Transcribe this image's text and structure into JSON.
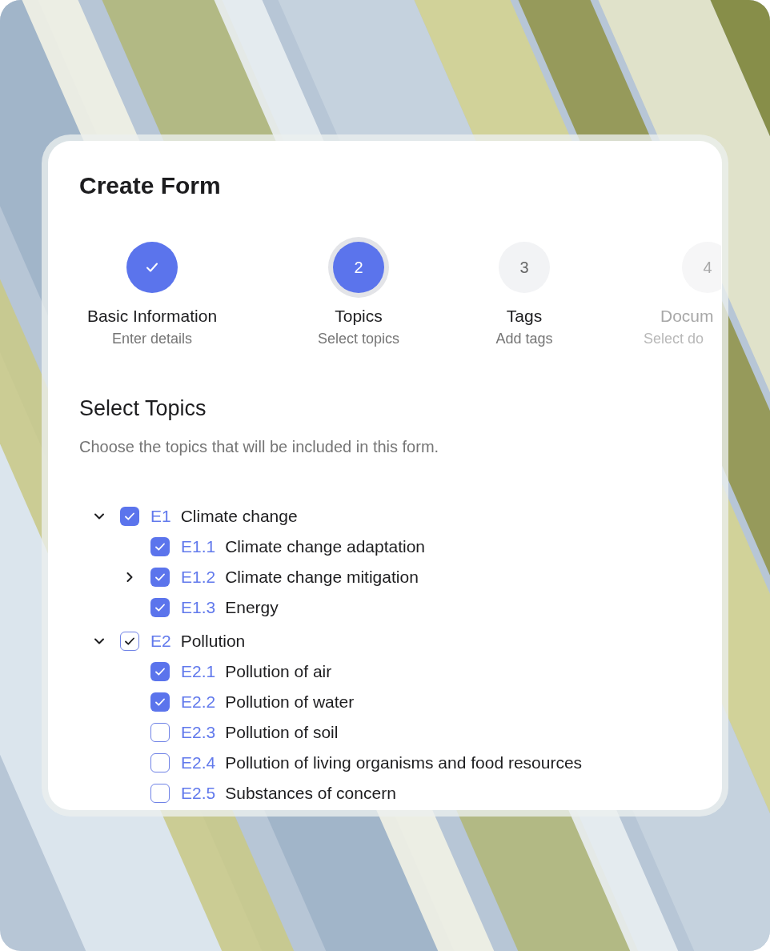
{
  "title": "Create Form",
  "steps": [
    {
      "completed": true,
      "selected": false,
      "disabled": false,
      "title": "Basic Information",
      "subtitle": "Enter details"
    },
    {
      "completed": false,
      "selected": true,
      "disabled": false,
      "number": "2",
      "title": "Topics",
      "subtitle": "Select topics"
    },
    {
      "completed": false,
      "selected": false,
      "disabled": false,
      "number": "3",
      "title": "Tags",
      "subtitle": "Add tags"
    },
    {
      "completed": false,
      "selected": false,
      "disabled": true,
      "number": "4",
      "title": "Docum",
      "subtitle": "Select do"
    }
  ],
  "section": {
    "heading": "Select Topics",
    "description": "Choose the topics that will be included in this form."
  },
  "topics": [
    {
      "code": "E1",
      "label": "Climate change",
      "checked": true,
      "expanded": true,
      "children": [
        {
          "code": "E1.1",
          "label": "Climate change adaptation",
          "checked": true
        },
        {
          "code": "E1.2",
          "label": "Climate change mitigation",
          "checked": true,
          "expanded": false
        },
        {
          "code": "E1.3",
          "label": "Energy",
          "checked": true
        }
      ]
    },
    {
      "code": "E2",
      "label": "Pollution",
      "checked": true,
      "partial": true,
      "expanded": true,
      "children": [
        {
          "code": "E2.1",
          "label": "Pollution of air",
          "checked": true
        },
        {
          "code": "E2.2",
          "label": "Pollution of water",
          "checked": true
        },
        {
          "code": "E2.3",
          "label": "Pollution of soil",
          "checked": false
        },
        {
          "code": "E2.4",
          "label": "Pollution of living organisms and food resources",
          "checked": false
        },
        {
          "code": "E2.5",
          "label": "Substances of concern",
          "checked": false
        }
      ]
    }
  ]
}
